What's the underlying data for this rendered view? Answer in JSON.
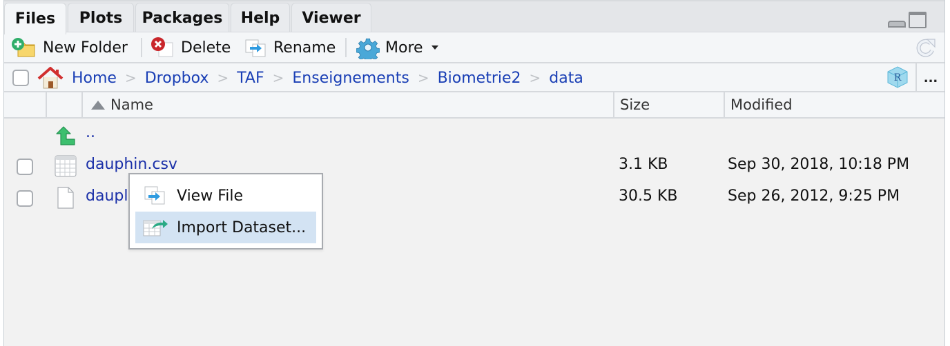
{
  "tabs": [
    {
      "label": "Files",
      "active": true
    },
    {
      "label": "Plots",
      "active": false
    },
    {
      "label": "Packages",
      "active": false
    },
    {
      "label": "Help",
      "active": false
    },
    {
      "label": "Viewer",
      "active": false
    }
  ],
  "toolbar": {
    "new_folder": "New Folder",
    "delete": "Delete",
    "rename": "Rename",
    "more": "More"
  },
  "breadcrumb": {
    "items": [
      "Home",
      "Dropbox",
      "TAF",
      "Enseignements",
      "Biometrie2",
      "data"
    ],
    "separator": ">",
    "more": "..."
  },
  "columns": {
    "name": "Name",
    "size": "Size",
    "modified": "Modified"
  },
  "files": [
    {
      "name": "..",
      "type": "parent",
      "size": "",
      "modified": ""
    },
    {
      "name": "dauphin.csv",
      "type": "csv",
      "size": "3.1 KB",
      "modified": "Sep 30, 2018, 10:18 PM"
    },
    {
      "name": "dauphin.txt",
      "visible_name": "daupl",
      "type": "file",
      "size": "30.5 KB",
      "modified": "Sep 26, 2012, 9:25 PM"
    }
  ],
  "context_menu": {
    "items": [
      {
        "label": "View File",
        "icon": "view-file-icon",
        "highlighted": false
      },
      {
        "label": "Import Dataset...",
        "icon": "import-dataset-icon",
        "highlighted": true
      }
    ]
  },
  "colors": {
    "link": "#1a3fb5",
    "menu_highlight": "#d3e3f3",
    "accent_green": "#3cbf6e"
  }
}
